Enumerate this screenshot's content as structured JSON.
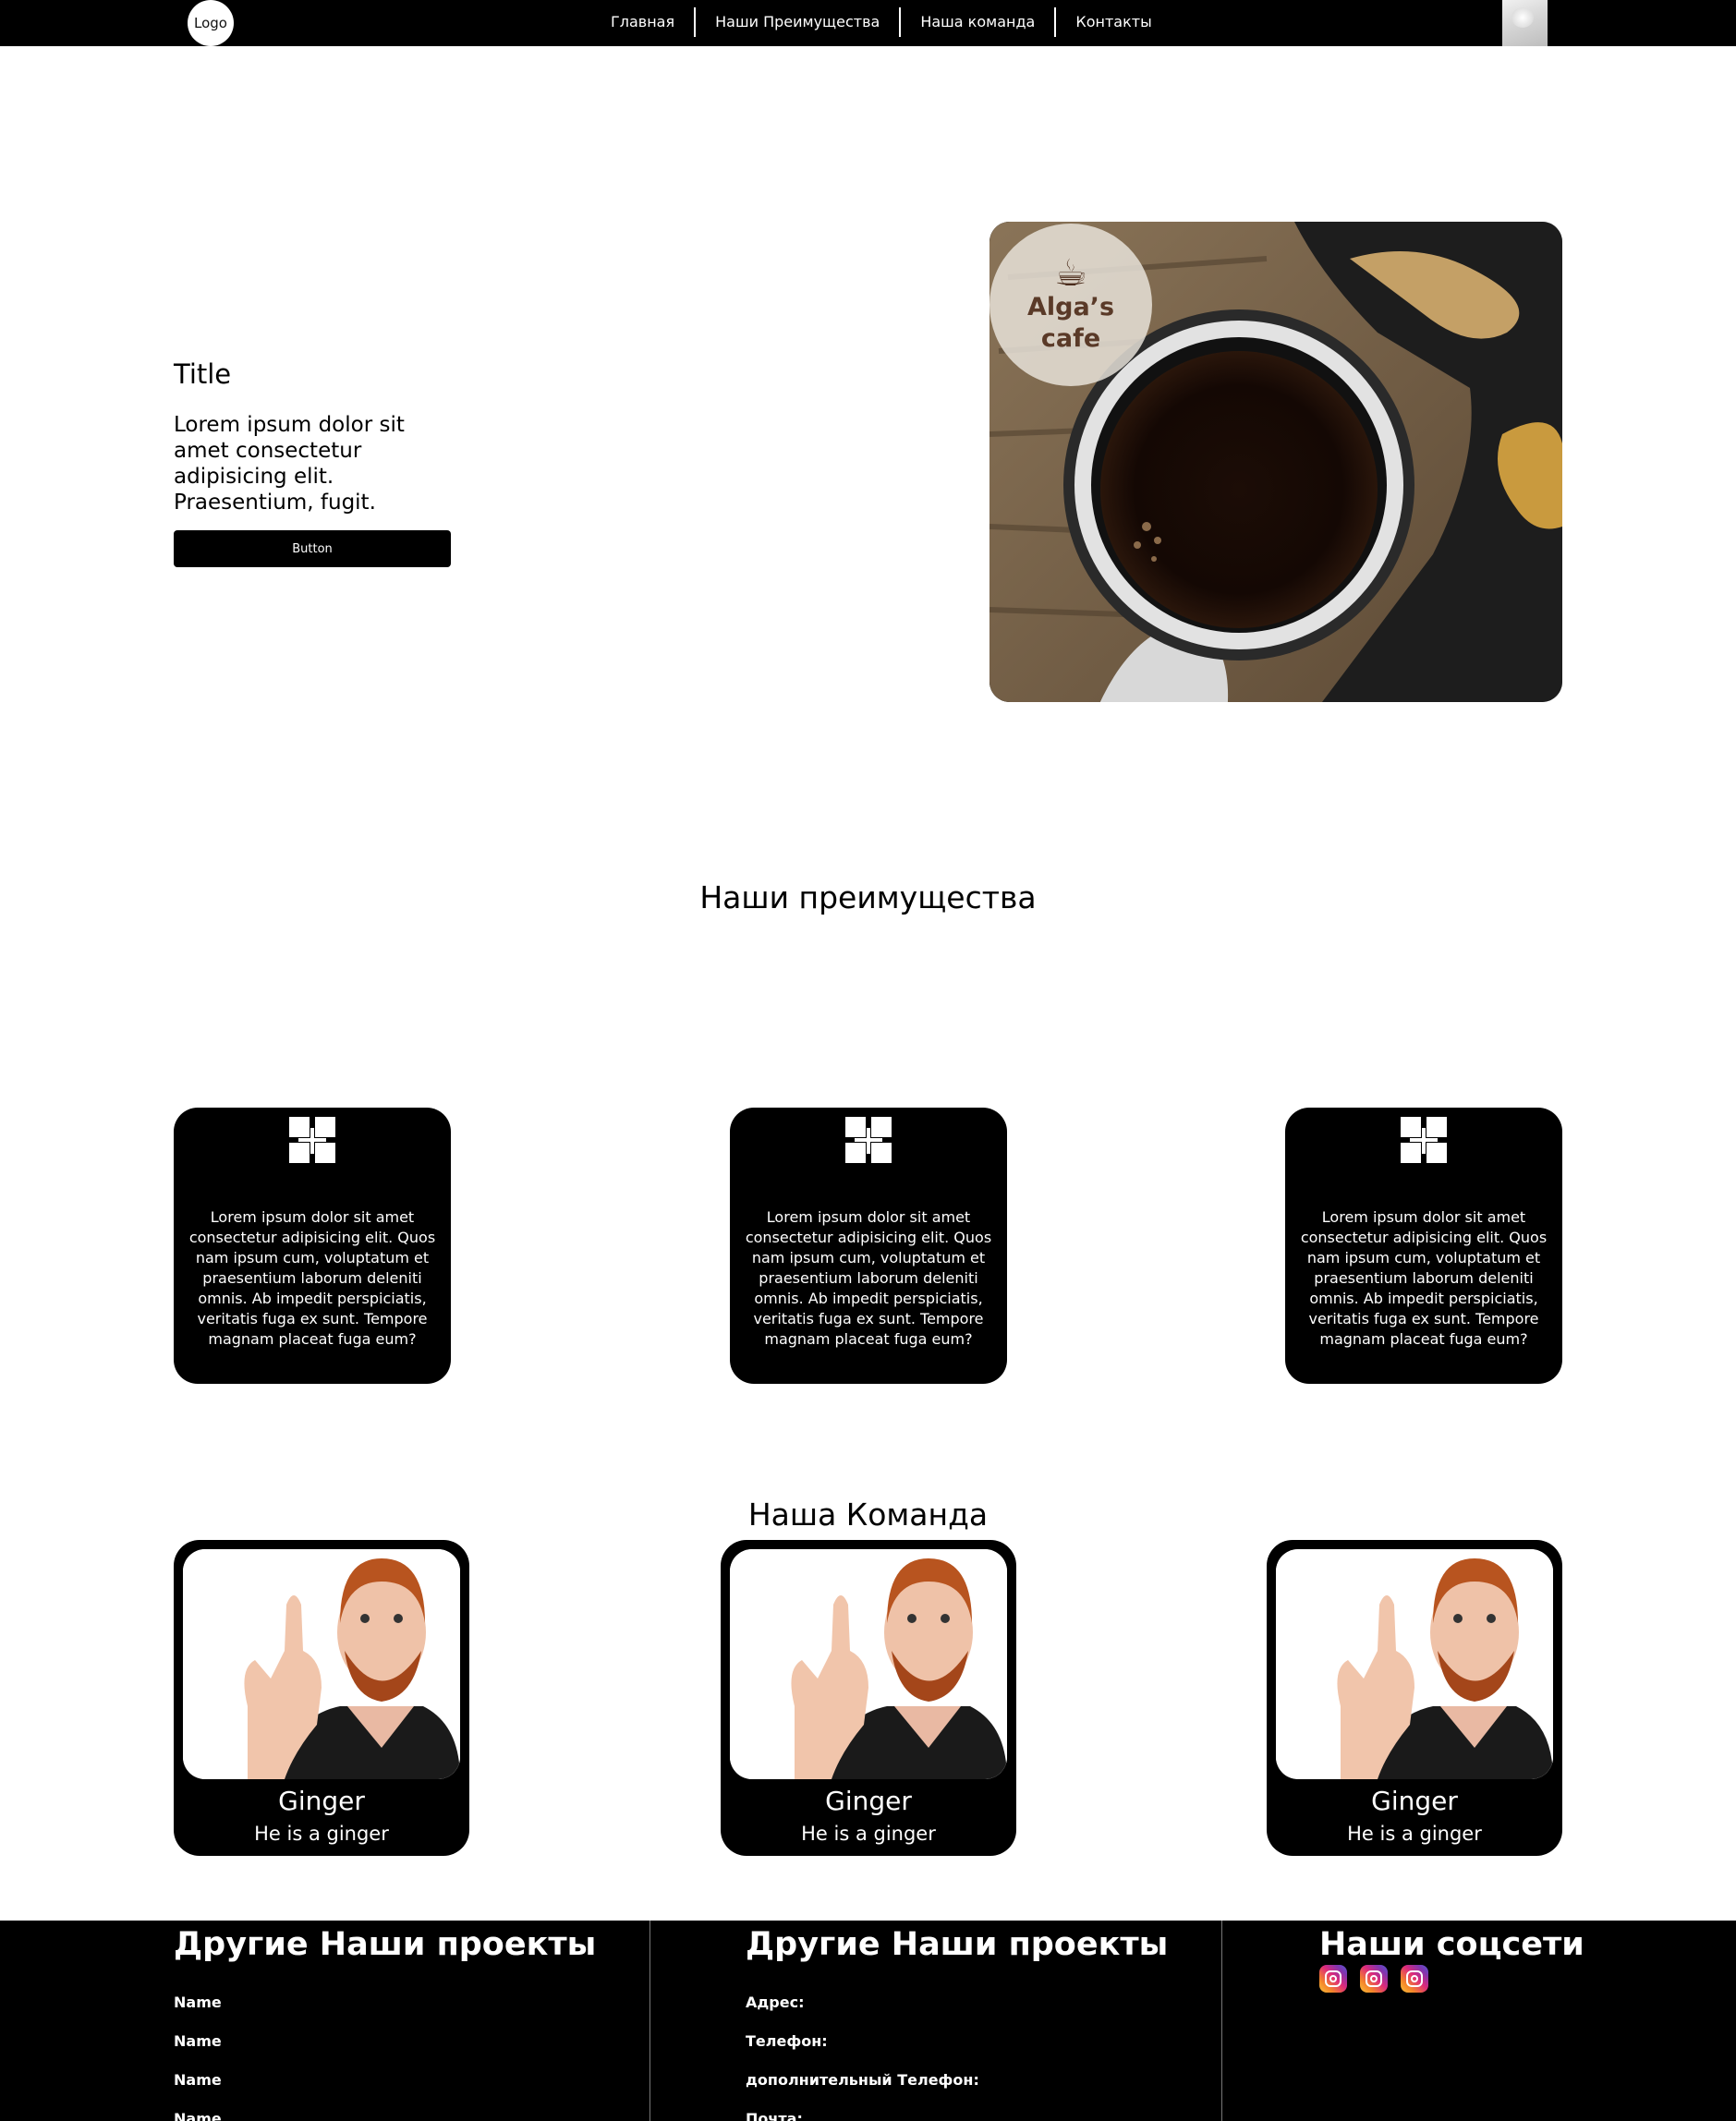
{
  "header": {
    "logo_text": "Logo",
    "nav": [
      "Главная",
      "Наши Преимущества",
      "Наша команда",
      "Контакты"
    ]
  },
  "hero": {
    "title": "Title",
    "text": "Lorem ipsum dolor sit amet consectetur adipisicing elit. Praesentium, fugit.",
    "button_label": "Button",
    "image_badge": {
      "line1": "Alga’s",
      "line2": "cafe"
    }
  },
  "advantages": {
    "title": "Наши преимущества",
    "cards": [
      {
        "icon": "grid-icon",
        "text": "Lorem ipsum dolor sit amet consectetur adipisicing elit. Quos nam ipsum cum, voluptatum et praesentium laborum deleniti omnis. Ab impedit perspiciatis, veritatis fuga ex sunt. Tempore magnam placeat fuga eum?"
      },
      {
        "icon": "grid-icon",
        "text": "Lorem ipsum dolor sit amet consectetur adipisicing elit. Quos nam ipsum cum, voluptatum et praesentium laborum deleniti omnis. Ab impedit perspiciatis, veritatis fuga ex sunt. Tempore magnam placeat fuga eum?"
      },
      {
        "icon": "grid-icon",
        "text": "Lorem ipsum dolor sit amet consectetur adipisicing elit. Quos nam ipsum cum, voluptatum et praesentium laborum deleniti omnis. Ab impedit perspiciatis, veritatis fuga ex sunt. Tempore magnam placeat fuga eum?"
      }
    ]
  },
  "team": {
    "title": "Наша Команда",
    "members": [
      {
        "name": "Ginger",
        "role": "He is a ginger"
      },
      {
        "name": "Ginger",
        "role": "He is a ginger"
      },
      {
        "name": "Ginger",
        "role": "He is a ginger"
      }
    ]
  },
  "footer": {
    "projects": {
      "heading": "Другие Наши проекты",
      "items": [
        "Name",
        "Name",
        "Name",
        "Name"
      ]
    },
    "contacts": {
      "heading": "Другие Наши проекты",
      "items": [
        "Адрес:",
        "Телефон:",
        "дополнительный Телефон:",
        "Почта:"
      ]
    },
    "social": {
      "heading": "Наши соцсети",
      "icons": [
        "instagram-icon",
        "instagram-icon",
        "instagram-icon"
      ]
    }
  }
}
